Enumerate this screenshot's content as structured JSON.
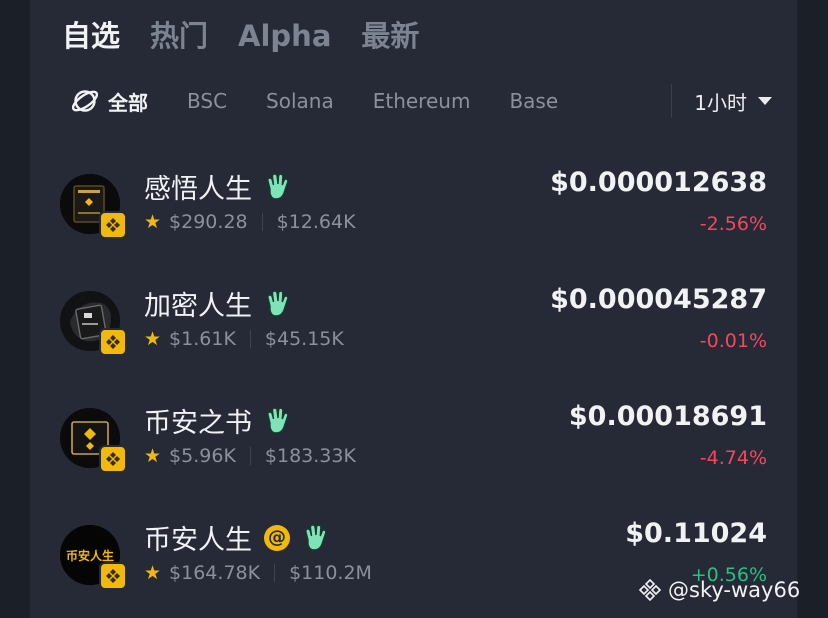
{
  "tabs": [
    {
      "label": "自选",
      "active": true
    },
    {
      "label": "热门",
      "active": false
    },
    {
      "label": "Alpha",
      "active": false
    },
    {
      "label": "最新",
      "active": false
    }
  ],
  "chains": {
    "all_label": "全部",
    "items": [
      "BSC",
      "Solana",
      "Ethereum",
      "Base"
    ]
  },
  "timeframe": {
    "label": "1小时"
  },
  "tokens": [
    {
      "name": "感悟人生",
      "market_cap": "$290.28",
      "volume": "$12.64K",
      "price": "$0.000012638",
      "change": "-2.56%",
      "trend": "down"
    },
    {
      "name": "加密人生",
      "market_cap": "$1.61K",
      "volume": "$45.15K",
      "price": "$0.000045287",
      "change": "-0.01%",
      "trend": "down"
    },
    {
      "name": "币安之书",
      "market_cap": "$5.96K",
      "volume": "$183.33K",
      "price": "$0.00018691",
      "change": "-4.74%",
      "trend": "down"
    },
    {
      "name": "币安人生",
      "market_cap": "$164.78K",
      "volume": "$110.2M",
      "price": "$0.11024",
      "change": "+0.56%",
      "trend": "up",
      "avatar_text": "币安人生"
    }
  ],
  "watermark": {
    "text": "@sky-way66"
  },
  "colors": {
    "accent": "#f0b90b",
    "negative": "#f6465d",
    "positive": "#2ebd85",
    "hand_icon": "#7ee3b8"
  },
  "icons": [
    "globe-icon",
    "chevron-down-icon",
    "bnb-chain-icon",
    "raised-hand-icon",
    "star-icon",
    "binance-logo-icon"
  ]
}
